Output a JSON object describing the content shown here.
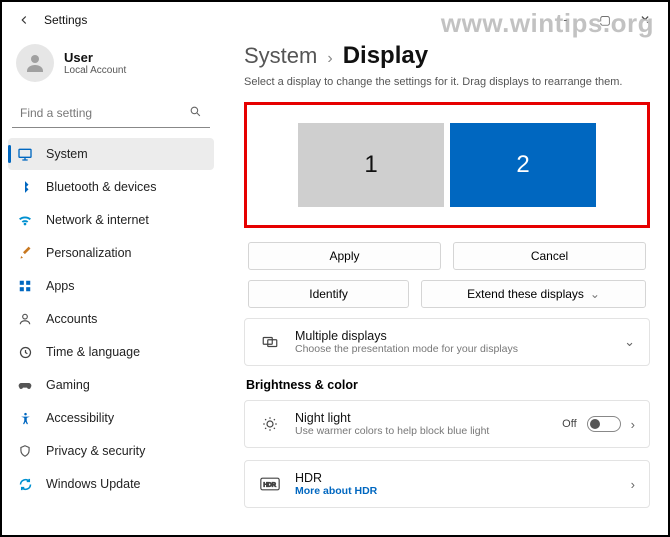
{
  "app": {
    "title": "Settings"
  },
  "watermark": "www.wintips.org",
  "user": {
    "name": "User",
    "sub": "Local Account"
  },
  "search": {
    "placeholder": "Find a setting"
  },
  "sidebar": {
    "items": [
      {
        "label": "System"
      },
      {
        "label": "Bluetooth & devices"
      },
      {
        "label": "Network & internet"
      },
      {
        "label": "Personalization"
      },
      {
        "label": "Apps"
      },
      {
        "label": "Accounts"
      },
      {
        "label": "Time & language"
      },
      {
        "label": "Gaming"
      },
      {
        "label": "Accessibility"
      },
      {
        "label": "Privacy & security"
      },
      {
        "label": "Windows Update"
      }
    ]
  },
  "breadcrumb": {
    "parent": "System",
    "current": "Display"
  },
  "instruction": "Select a display to change the settings for it. Drag displays to rearrange them.",
  "displays": {
    "d1": "1",
    "d2": "2"
  },
  "buttons": {
    "apply": "Apply",
    "cancel": "Cancel",
    "identify": "Identify",
    "extend": "Extend these displays"
  },
  "multi": {
    "title": "Multiple displays",
    "sub": "Choose the presentation mode for your displays"
  },
  "section_bc": "Brightness & color",
  "nightlight": {
    "title": "Night light",
    "sub": "Use warmer colors to help block blue light",
    "state": "Off"
  },
  "hdr": {
    "title": "HDR",
    "link": "More about HDR"
  }
}
